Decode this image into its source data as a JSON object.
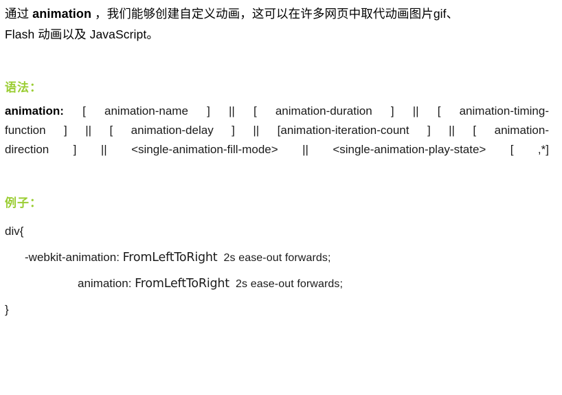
{
  "document": {
    "background_color": "#ffffff",
    "text_color": "#000000",
    "heading_color": "#9ACD32"
  },
  "intro": {
    "line1_prefix": "通过 ",
    "line1_bold": "animation",
    "line1_suffix": " ，我们能够创建自定义动画，这可以在许多网页中取代动画图片gif、",
    "line2": "Flash 动画以及 JavaScript。"
  },
  "sections": {
    "syntax_heading": "语法：",
    "example_heading": "例子："
  },
  "syntax": {
    "property_label": "animation:",
    "line1_rest": " [ animation-name ] || [ animation-duration ] || [ animation-timing-",
    "line2": "function ] || [ animation-delay ] || [animation-iteration-count ] || [ animation-",
    "line3": "direction ] || <single-animation-fill-mode> || <single-animation-play-state> [ ,*]"
  },
  "example_code": {
    "line1": "div{",
    "line2_prop": "-webkit-animation: ",
    "line2_ident": "FromLeftToRight",
    "line2_val": "  2s ease-out forwards;",
    "line3_prop": "animation: ",
    "line3_ident": "FromLeftToRight",
    "line3_val": "  2s ease-out forwards;",
    "line4": "}"
  }
}
